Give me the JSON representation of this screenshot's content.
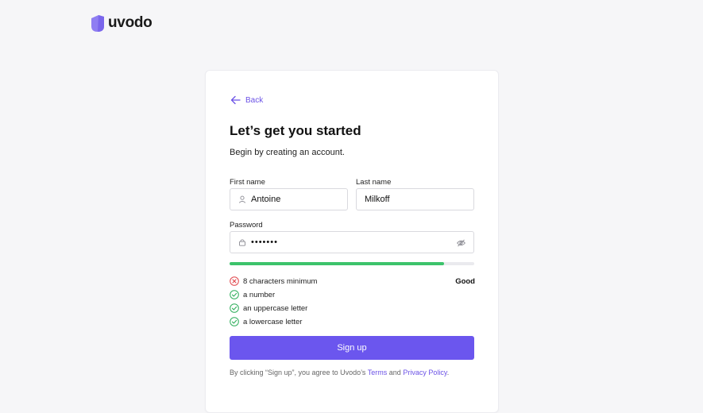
{
  "brand": {
    "name": "uvodo",
    "color": "#8f7ef2"
  },
  "back_label": "Back",
  "title": "Let’s get you started",
  "subtitle": "Begin by creating an account.",
  "form": {
    "first_name": {
      "label": "First name",
      "value": "Antoine",
      "icon": "user-icon"
    },
    "last_name": {
      "label": "Last name",
      "value": "Milkoff"
    },
    "password": {
      "label": "Password",
      "value": "•••••••",
      "icon": "lock-icon",
      "toggle_icon": "eye-icon"
    }
  },
  "strength": {
    "fraction": 0.875,
    "label": "Good",
    "color": "#3cc36b"
  },
  "requirements": [
    {
      "text": "8 characters minimum",
      "met": false
    },
    {
      "text": "a number",
      "met": true
    },
    {
      "text": "an uppercase letter",
      "met": true
    },
    {
      "text": "a lowercase letter",
      "met": true
    }
  ],
  "signup_label": "Sign up",
  "legal": {
    "prefix": "By clicking “Sign up”, you agree to Uvodo’s",
    "terms": "Terms",
    "and": "and",
    "privacy": "Privacy Policy",
    "suffix": "."
  },
  "colors": {
    "accent": "#6b56ee",
    "error": "#e0474c",
    "success": "#2fae5b"
  }
}
